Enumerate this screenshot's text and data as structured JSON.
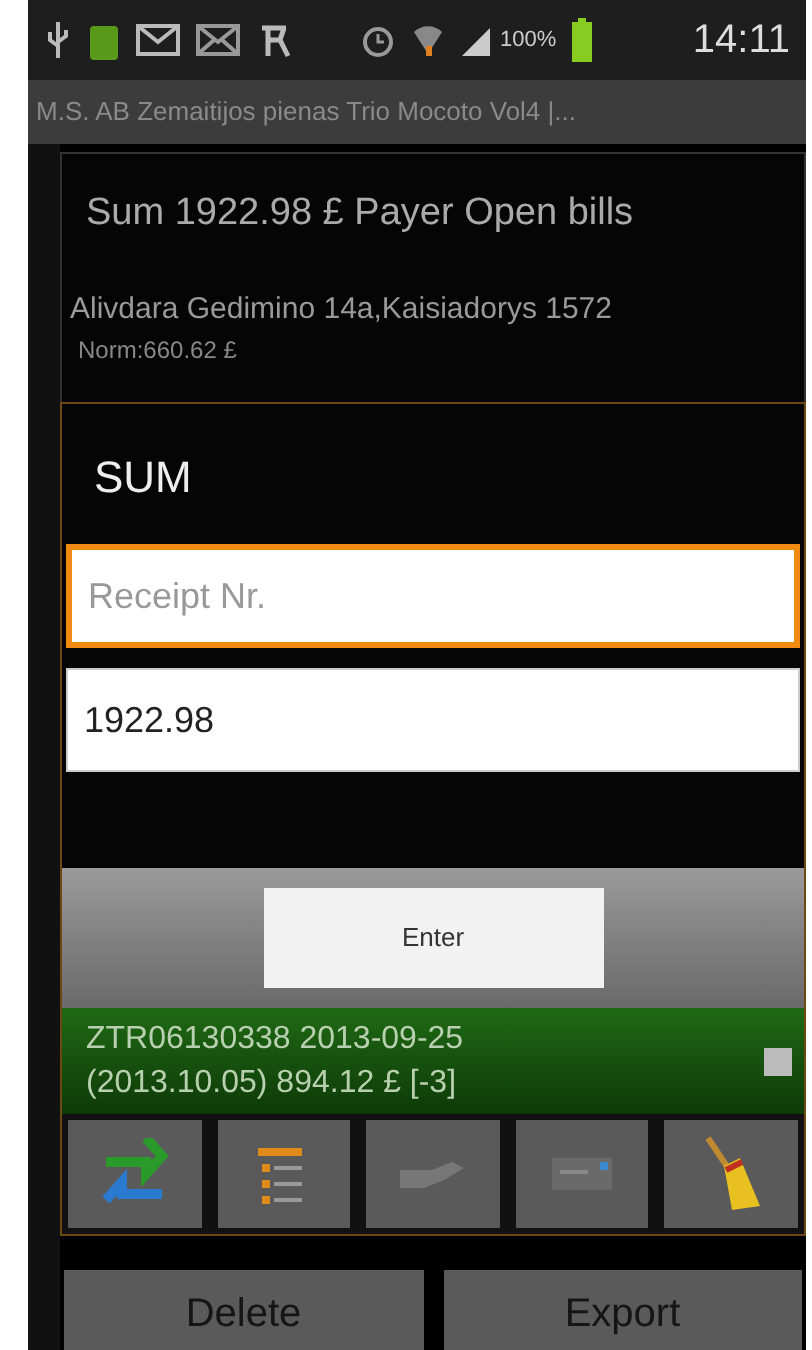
{
  "status_bar": {
    "battery_text": "100%",
    "time": "14:11"
  },
  "app_title": "M.S. AB Zemaitijos pienas Trio Mocoto Vol4 |...",
  "payer_dialog": {
    "title": "Sum 1922.98 £ Payer Open bills",
    "address": "Alivdara Gedimino 14a,Kaisiadorys 1572",
    "norm": "Norm:660.62 £"
  },
  "sum_dialog": {
    "title": "SUM",
    "fields": [
      {
        "placeholder": "Receipt Nr.",
        "focused": true
      },
      {
        "value": "1922.98",
        "focused": false
      }
    ],
    "button": "Enter"
  },
  "bill_row": {
    "lines": [
      "ZTR06130338 2013-09-25",
      "(2013.10.05) 894.12 £ [-3]"
    ],
    "checked": false
  },
  "buttons": [
    "Delete",
    "Export"
  ]
}
